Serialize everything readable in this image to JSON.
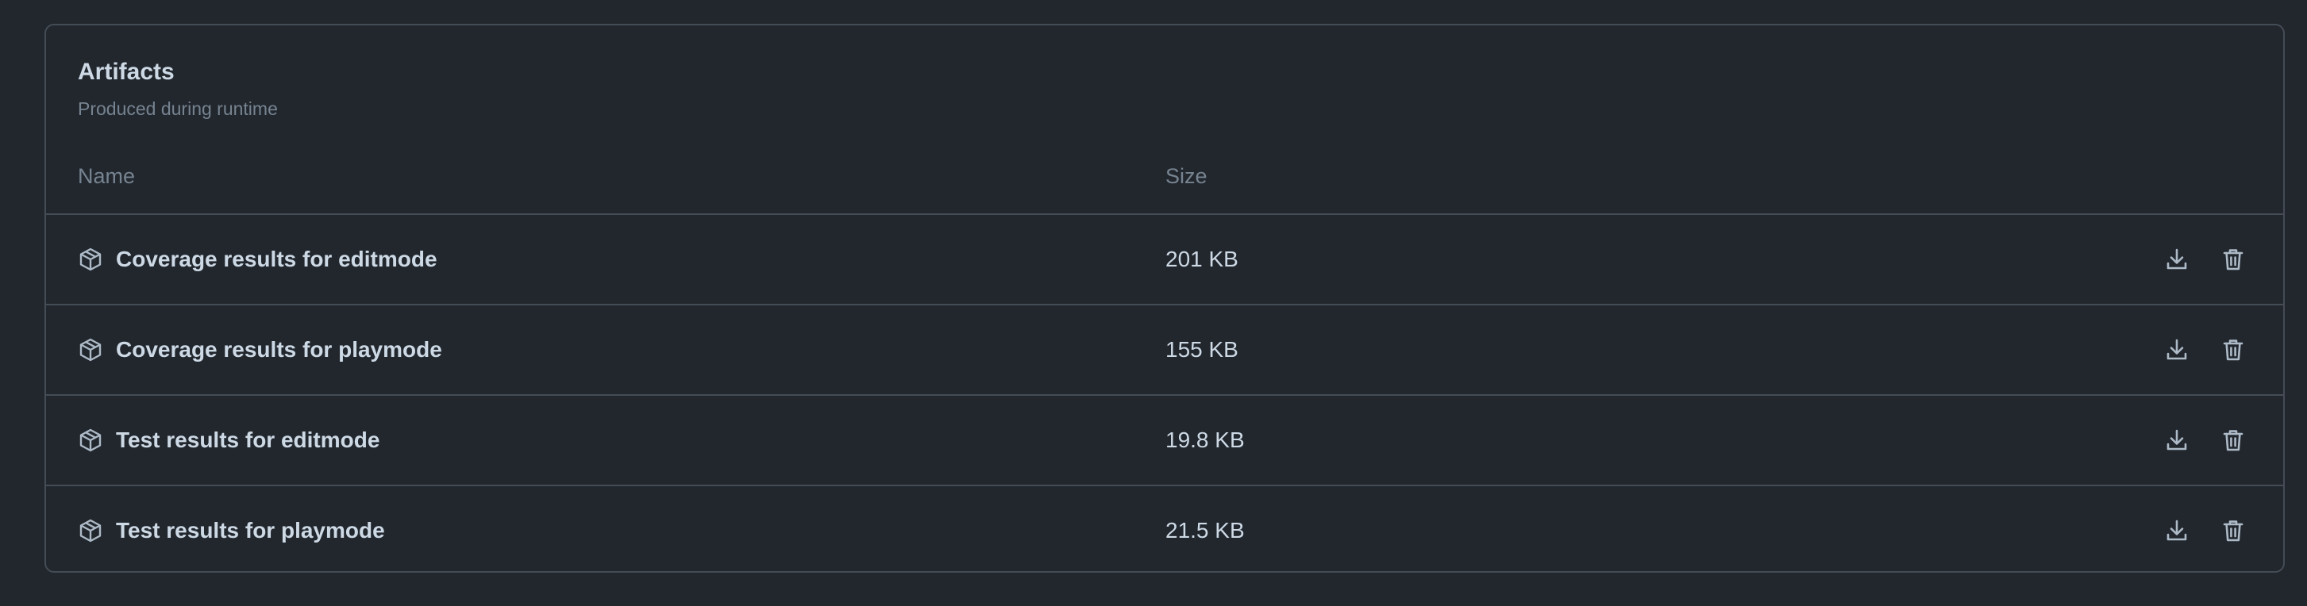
{
  "artifacts": {
    "title": "Artifacts",
    "subtitle": "Produced during runtime",
    "columns": {
      "name": "Name",
      "size": "Size"
    },
    "rows": [
      {
        "name": "Coverage results for editmode",
        "size": "201 KB",
        "icon": "package-icon"
      },
      {
        "name": "Coverage results for playmode",
        "size": "155 KB",
        "icon": "package-icon"
      },
      {
        "name": "Test results for editmode",
        "size": "19.8 KB",
        "icon": "package-icon"
      },
      {
        "name": "Test results for playmode",
        "size": "21.5 KB",
        "icon": "package-icon"
      }
    ],
    "row_actions": [
      "download-icon",
      "trash-icon"
    ]
  },
  "colors": {
    "background": "#22272e",
    "border": "#444c56",
    "text_primary": "#cdd9e5",
    "text_muted": "#768390",
    "icon": "#adbac7"
  }
}
